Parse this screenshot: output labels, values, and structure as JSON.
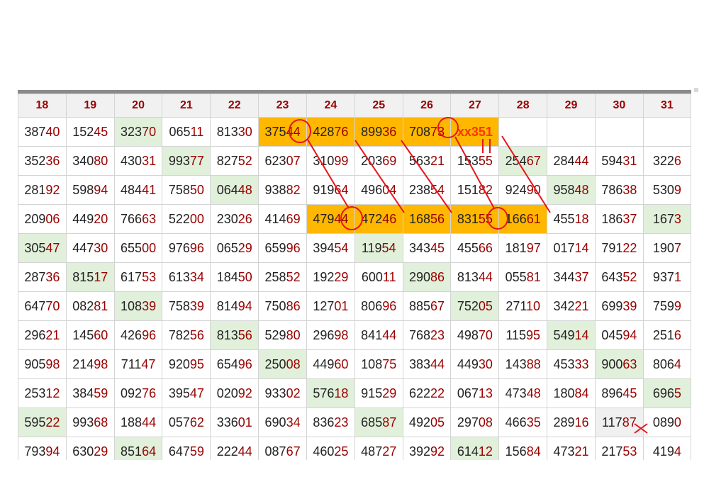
{
  "columns": [
    "18",
    "19",
    "20",
    "21",
    "22",
    "23",
    "24",
    "25",
    "26",
    "27",
    "28",
    "29",
    "30",
    "31"
  ],
  "rows": [
    {
      "cells": [
        [
          "387",
          "40"
        ],
        [
          "152",
          "45"
        ],
        [
          "323",
          "70"
        ],
        [
          "065",
          "11"
        ],
        [
          "813",
          "30"
        ],
        [
          "375",
          "44"
        ],
        [
          "428",
          "76"
        ],
        [
          "899",
          "36"
        ],
        [
          "708",
          "73"
        ],
        [
          "xx351",
          ""
        ],
        [
          "",
          ""
        ],
        [
          "",
          ""
        ],
        [
          "",
          ""
        ],
        [
          "",
          ""
        ]
      ],
      "marks": {
        "2": "g",
        "5": "o",
        "6": "o",
        "7": "o",
        "8": "o",
        "9": "o"
      }
    },
    {
      "cells": [
        [
          "352",
          "36"
        ],
        [
          "340",
          "80"
        ],
        [
          "430",
          "31"
        ],
        [
          "993",
          "77"
        ],
        [
          "827",
          "52"
        ],
        [
          "623",
          "07"
        ],
        [
          "310",
          "99"
        ],
        [
          "203",
          "69"
        ],
        [
          "563",
          "21"
        ],
        [
          "153",
          "55"
        ],
        [
          "254",
          "67"
        ],
        [
          "284",
          "44"
        ],
        [
          "594",
          "31"
        ],
        [
          "322",
          "6"
        ]
      ],
      "marks": {
        "3": "g",
        "10": "g"
      }
    },
    {
      "cells": [
        [
          "281",
          "92"
        ],
        [
          "598",
          "94"
        ],
        [
          "484",
          "41"
        ],
        [
          "758",
          "50"
        ],
        [
          "064",
          "48"
        ],
        [
          "938",
          "82"
        ],
        [
          "919",
          "64"
        ],
        [
          "496",
          "04"
        ],
        [
          "238",
          "54"
        ],
        [
          "151",
          "82"
        ],
        [
          "924",
          "90"
        ],
        [
          "958",
          "48"
        ],
        [
          "786",
          "38"
        ],
        [
          "530",
          "9"
        ]
      ],
      "marks": {
        "4": "g",
        "11": "g"
      }
    },
    {
      "cells": [
        [
          "209",
          "06"
        ],
        [
          "449",
          "20"
        ],
        [
          "766",
          "63"
        ],
        [
          "522",
          "00"
        ],
        [
          "230",
          "26"
        ],
        [
          "414",
          "69"
        ],
        [
          "479",
          "44"
        ],
        [
          "472",
          "46"
        ],
        [
          "168",
          "56"
        ],
        [
          "831",
          "55"
        ],
        [
          "166",
          "61"
        ],
        [
          "455",
          "18"
        ],
        [
          "186",
          "37"
        ],
        [
          "167",
          "3"
        ]
      ],
      "marks": {
        "6": "o",
        "7": "o",
        "8": "o",
        "9": "o",
        "10": "o",
        "13": "g"
      }
    },
    {
      "cells": [
        [
          "305",
          "47"
        ],
        [
          "447",
          "30"
        ],
        [
          "655",
          "00"
        ],
        [
          "976",
          "96"
        ],
        [
          "065",
          "29"
        ],
        [
          "659",
          "96"
        ],
        [
          "394",
          "54"
        ],
        [
          "119",
          "54"
        ],
        [
          "343",
          "45"
        ],
        [
          "455",
          "66"
        ],
        [
          "181",
          "97"
        ],
        [
          "017",
          "14"
        ],
        [
          "791",
          "22"
        ],
        [
          "190",
          "7"
        ]
      ],
      "marks": {
        "0": "g",
        "7": "g"
      }
    },
    {
      "cells": [
        [
          "287",
          "36"
        ],
        [
          "815",
          "17"
        ],
        [
          "617",
          "53"
        ],
        [
          "613",
          "34"
        ],
        [
          "184",
          "50"
        ],
        [
          "258",
          "52"
        ],
        [
          "192",
          "29"
        ],
        [
          "600",
          "11"
        ],
        [
          "290",
          "86"
        ],
        [
          "813",
          "44"
        ],
        [
          "055",
          "81"
        ],
        [
          "344",
          "37"
        ],
        [
          "643",
          "52"
        ],
        [
          "937",
          "1"
        ]
      ],
      "marks": {
        "1": "g",
        "8": "g"
      }
    },
    {
      "cells": [
        [
          "647",
          "70"
        ],
        [
          "082",
          "81"
        ],
        [
          "108",
          "39"
        ],
        [
          "758",
          "39"
        ],
        [
          "814",
          "94"
        ],
        [
          "750",
          "86"
        ],
        [
          "127",
          "01"
        ],
        [
          "806",
          "96"
        ],
        [
          "885",
          "67"
        ],
        [
          "752",
          "05"
        ],
        [
          "271",
          "10"
        ],
        [
          "342",
          "21"
        ],
        [
          "699",
          "39"
        ],
        [
          "759",
          "9"
        ]
      ],
      "marks": {
        "2": "g",
        "9": "g"
      }
    },
    {
      "cells": [
        [
          "296",
          "21"
        ],
        [
          "145",
          "60"
        ],
        [
          "426",
          "96"
        ],
        [
          "782",
          "56"
        ],
        [
          "813",
          "56"
        ],
        [
          "529",
          "80"
        ],
        [
          "296",
          "98"
        ],
        [
          "841",
          "44"
        ],
        [
          "768",
          "23"
        ],
        [
          "498",
          "70"
        ],
        [
          "115",
          "95"
        ],
        [
          "549",
          "14"
        ],
        [
          "045",
          "94"
        ],
        [
          "251",
          "6"
        ]
      ],
      "marks": {
        "4": "g",
        "11": "g"
      }
    },
    {
      "cells": [
        [
          "905",
          "98"
        ],
        [
          "214",
          "98"
        ],
        [
          "711",
          "47"
        ],
        [
          "920",
          "95"
        ],
        [
          "654",
          "96"
        ],
        [
          "250",
          "08"
        ],
        [
          "449",
          "60"
        ],
        [
          "108",
          "75"
        ],
        [
          "383",
          "44"
        ],
        [
          "449",
          "30"
        ],
        [
          "143",
          "88"
        ],
        [
          "453",
          "33"
        ],
        [
          "900",
          "63"
        ],
        [
          "806",
          "4"
        ]
      ],
      "marks": {
        "5": "g",
        "12": "g"
      }
    },
    {
      "cells": [
        [
          "253",
          "12"
        ],
        [
          "384",
          "59"
        ],
        [
          "092",
          "76"
        ],
        [
          "395",
          "47"
        ],
        [
          "020",
          "92"
        ],
        [
          "933",
          "02"
        ],
        [
          "576",
          "18"
        ],
        [
          "915",
          "29"
        ],
        [
          "622",
          "22"
        ],
        [
          "067",
          "13"
        ],
        [
          "473",
          "48"
        ],
        [
          "180",
          "84"
        ],
        [
          "896",
          "45"
        ],
        [
          "696",
          "5"
        ]
      ],
      "marks": {
        "6": "g",
        "13": "g"
      }
    },
    {
      "cells": [
        [
          "595",
          "22"
        ],
        [
          "993",
          "68"
        ],
        [
          "188",
          "44"
        ],
        [
          "057",
          "62"
        ],
        [
          "336",
          "01"
        ],
        [
          "690",
          "34"
        ],
        [
          "836",
          "23"
        ],
        [
          "685",
          "87"
        ],
        [
          "492",
          "05"
        ],
        [
          "297",
          "08"
        ],
        [
          "466",
          "35"
        ],
        [
          "289",
          "16"
        ],
        [
          "117",
          "87"
        ],
        [
          "089",
          "0"
        ]
      ],
      "marks": {
        "0": "g",
        "7": "g",
        "12": "x"
      }
    },
    {
      "cells": [
        [
          "793",
          "94"
        ],
        [
          "630",
          "29"
        ],
        [
          "851",
          "64"
        ],
        [
          "647",
          "59"
        ],
        [
          "222",
          "44"
        ],
        [
          "087",
          "67"
        ],
        [
          "460",
          "25"
        ],
        [
          "487",
          "27"
        ],
        [
          "392",
          "92"
        ],
        [
          "614",
          "12"
        ],
        [
          "156",
          "84"
        ],
        [
          "473",
          "21"
        ],
        [
          "217",
          "53"
        ],
        [
          "419",
          "4"
        ]
      ],
      "marks": {
        "2": "g",
        "9": "g"
      }
    }
  ],
  "colors": {
    "accent": "#ffb700",
    "green_cell": "#e1f0da",
    "digit_red": "#990000",
    "annotation": "#e8141b"
  },
  "annotation_icons": [
    "circle-mark",
    "connector-line",
    "x-mark"
  ]
}
